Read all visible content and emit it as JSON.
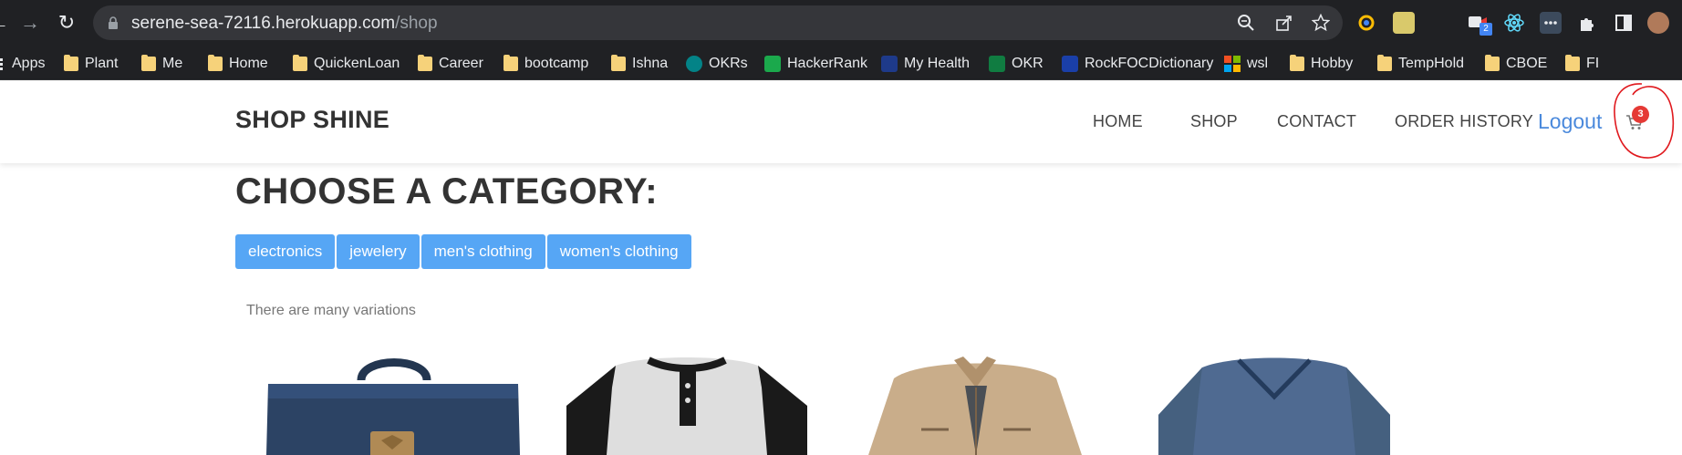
{
  "browser": {
    "url_host": "serene-sea-72116.herokuapp.com",
    "url_path": "/shop",
    "extension_badge": "2"
  },
  "bookmarks": [
    {
      "label": "Apps",
      "icon": "apps-grid-icon"
    },
    {
      "label": "Plant",
      "icon": "folder-icon"
    },
    {
      "label": "Me",
      "icon": "folder-icon"
    },
    {
      "label": "Home",
      "icon": "folder-icon"
    },
    {
      "label": "QuickenLoan",
      "icon": "folder-icon"
    },
    {
      "label": "Career",
      "icon": "folder-icon"
    },
    {
      "label": "bootcamp",
      "icon": "folder-icon"
    },
    {
      "label": "Ishna",
      "icon": "folder-icon"
    },
    {
      "label": "OKRs",
      "icon": "sharepoint-icon"
    },
    {
      "label": "HackerRank",
      "icon": "hackerrank-icon"
    },
    {
      "label": "My Health",
      "icon": "webmd-icon"
    },
    {
      "label": "OKR",
      "icon": "excel-icon"
    },
    {
      "label": "RockFOCDictionary",
      "icon": "dictionary-icon"
    },
    {
      "label": "wsl",
      "icon": "windows-icon"
    },
    {
      "label": "Hobby",
      "icon": "folder-icon"
    },
    {
      "label": "TempHold",
      "icon": "folder-icon"
    },
    {
      "label": "CBOE",
      "icon": "folder-icon"
    },
    {
      "label": "FI",
      "icon": "folder-icon"
    }
  ],
  "header": {
    "brand": "SHOP SHINE",
    "nav": [
      "HOME",
      "SHOP",
      "CONTACT",
      "ORDER HISTORY"
    ],
    "logout": "Logout",
    "cart_count": "3"
  },
  "main": {
    "title": "CHOOSE A CATEGORY:",
    "categories": [
      "electronics",
      "jewelery",
      "men's clothing",
      "women's clothing"
    ],
    "tagline": "There are many variations"
  },
  "colors": {
    "accent": "#56a6f5",
    "logout": "#4a89dc",
    "badge": "#e53935",
    "annotation": "#e0191e"
  }
}
